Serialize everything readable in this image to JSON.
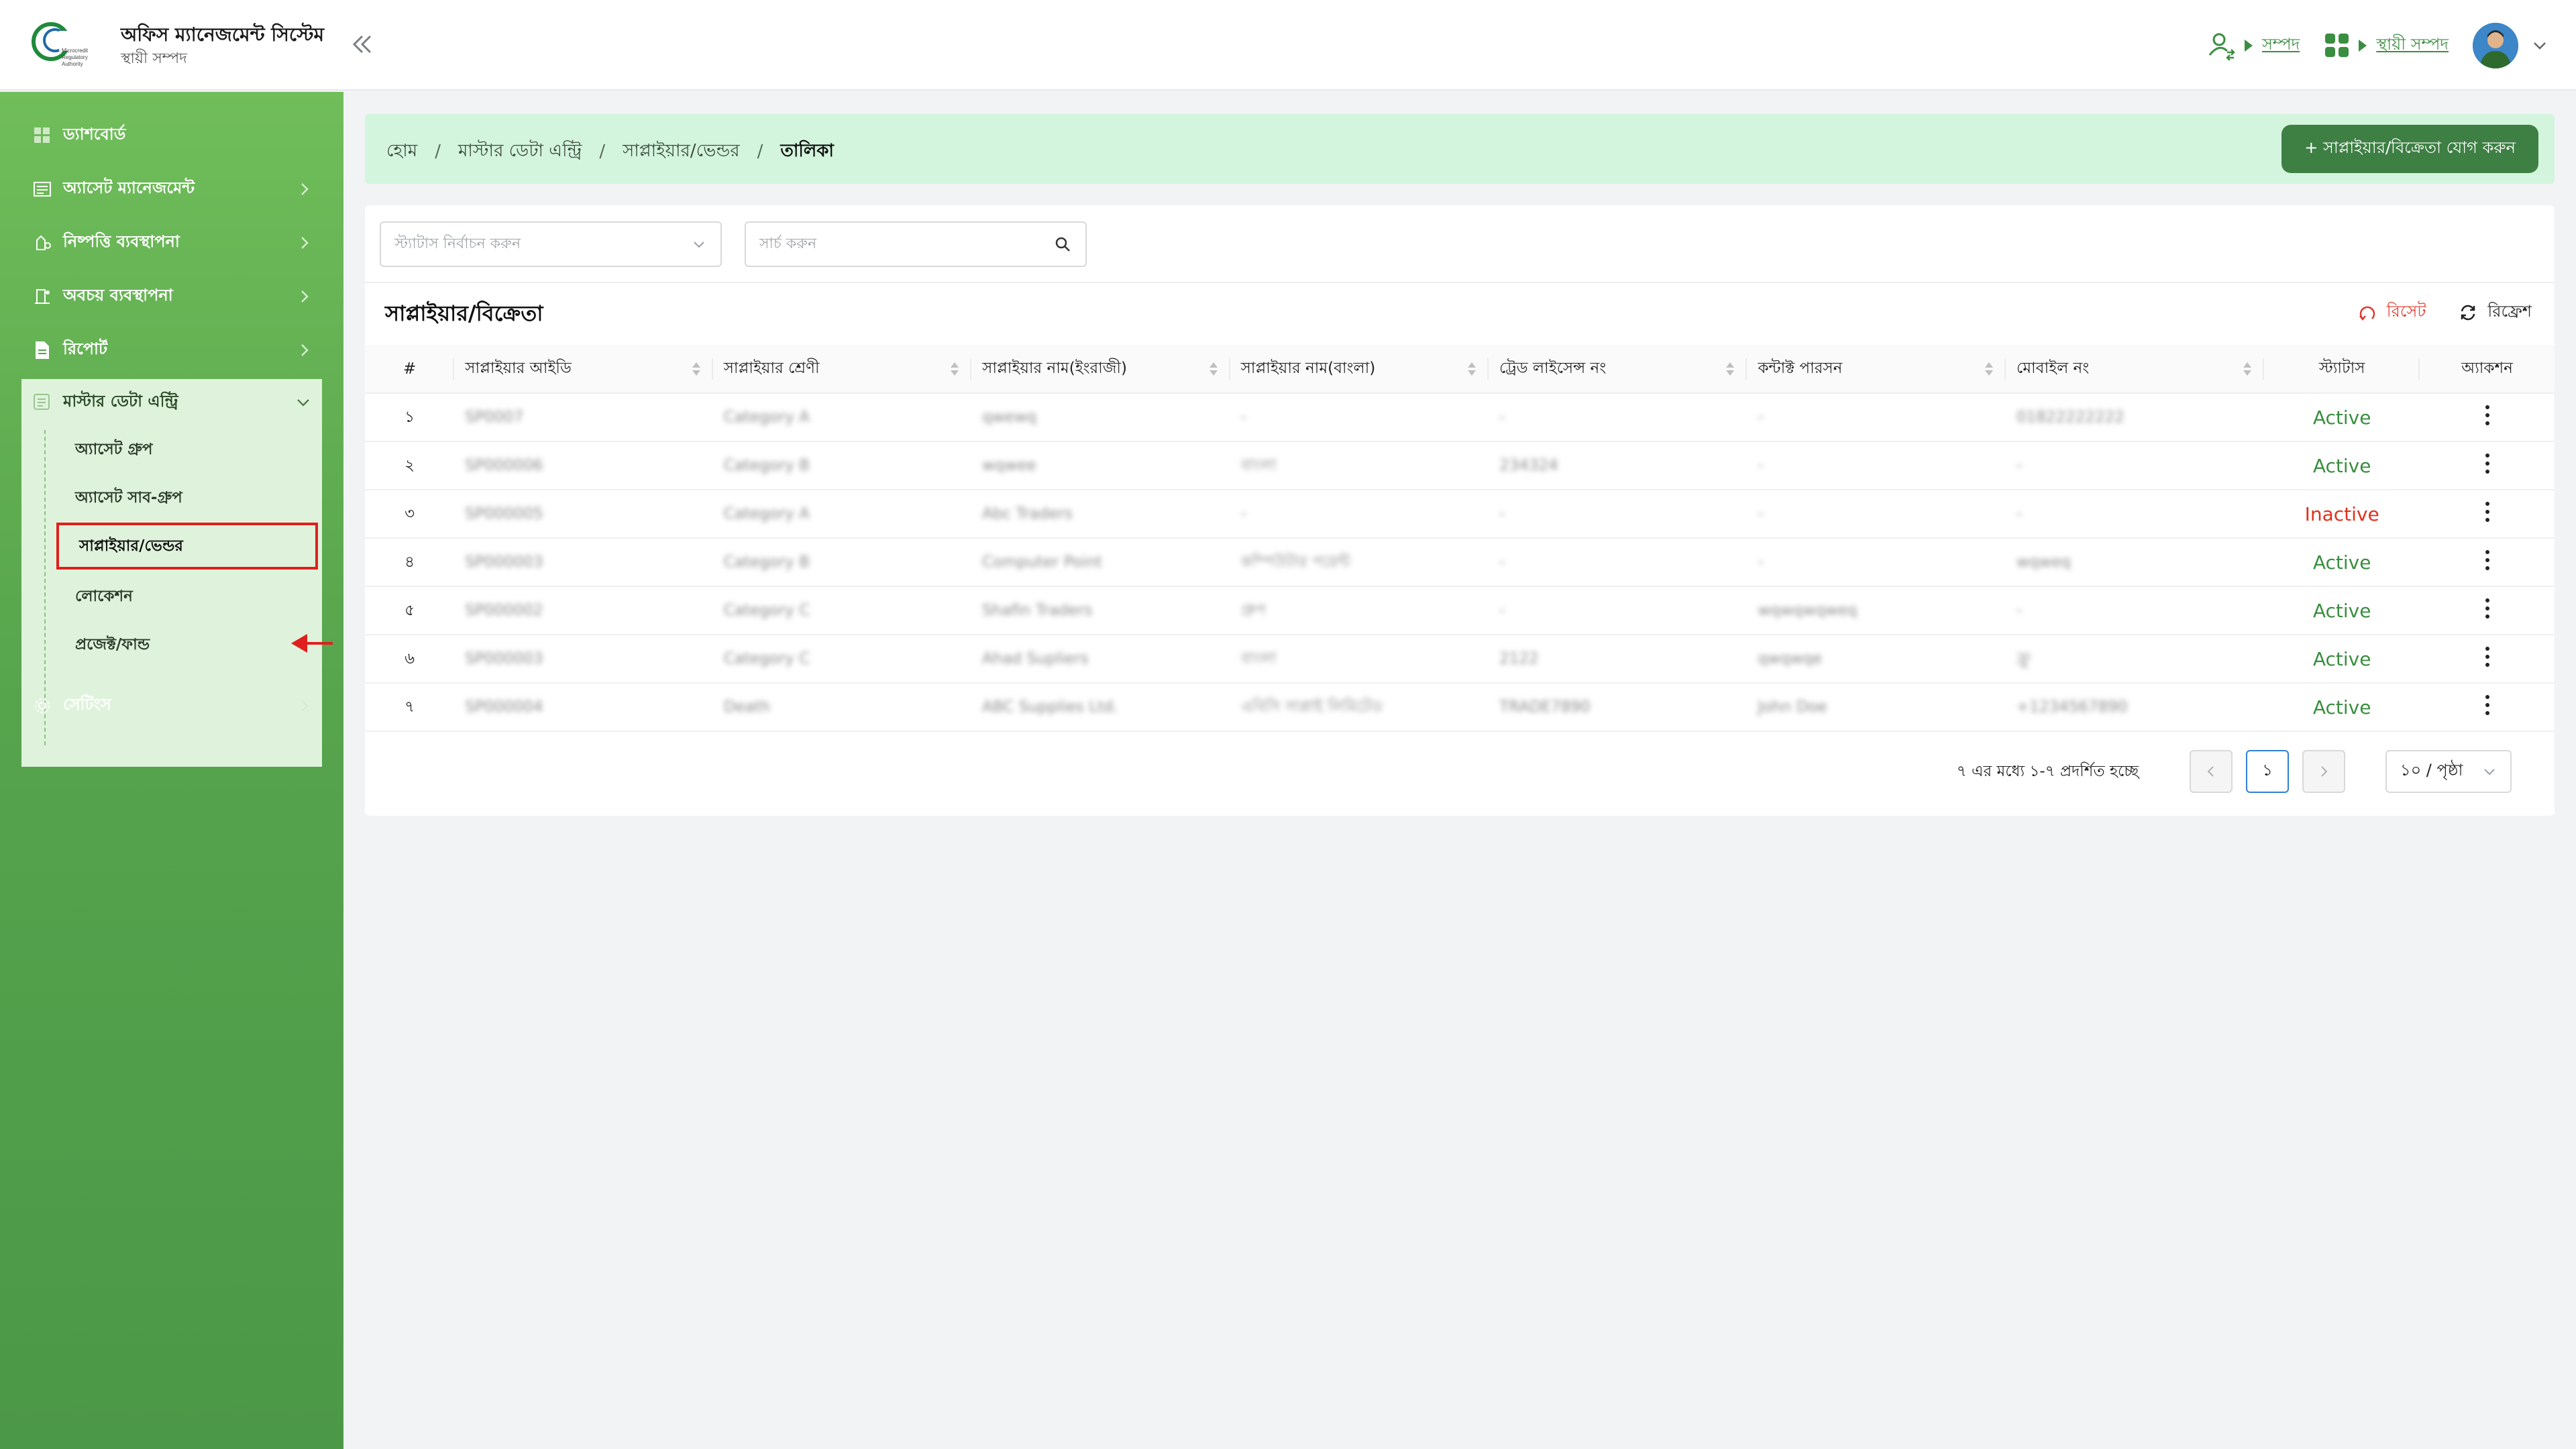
{
  "app": {
    "title": "অফিস ম্যানেজমেন্ট সিস্টেম",
    "subtitle": "স্থায়ী সম্পদ",
    "logo_text": "Microcredit Regulatory Authority"
  },
  "header": {
    "link_1": "সম্পদ",
    "link_2": "স্থায়ী সম্পদ",
    "accent_color": "#3a8e40"
  },
  "sidebar": {
    "items": [
      {
        "label": "ড্যাশবোর্ড",
        "icon": "dashboard-icon"
      },
      {
        "label": "অ্যাসেট ম্যানেজমেন্ট",
        "icon": "asset-icon"
      },
      {
        "label": "নিষ্পত্তি ব্যবস্থাপনা",
        "icon": "disposal-icon"
      },
      {
        "label": "অবচয় ব্যবস্থাপনা",
        "icon": "depreciation-icon"
      },
      {
        "label": "রিপোর্ট",
        "icon": "report-icon"
      }
    ],
    "master": {
      "label": "মাস্টার ডেটা এন্ট্রি",
      "children": [
        "অ্যাসেট গ্রুপ",
        "অ্যাসেট সাব-গ্রুপ",
        "সাপ্লাইয়ার/ভেন্ডর",
        "লোকেশন",
        "প্রজেক্ট/ফান্ড"
      ]
    },
    "settings": "সেটিংস"
  },
  "breadcrumb": {
    "home": "হোম",
    "master": "মাস্টার ডেটা এন্ট্রি",
    "supplier": "সাপ্লাইয়ার/ভেন্ডর",
    "current": "তালিকা"
  },
  "add_button": "+ সাপ্লাইয়ার/বিক্রেতা যোগ করুন",
  "filters": {
    "status_placeholder": "স্ট্যাটাস নির্বাচন করুন",
    "search_placeholder": "সার্চ করুন"
  },
  "table": {
    "title": "সাপ্লাইয়ার/বিক্রেতা",
    "reset": "রিসেট",
    "refresh": "রিফ্রেশ",
    "columns": [
      "#",
      "সাপ্লাইয়ার আইডি",
      "সাপ্লাইয়ার শ্রেণী",
      "সাপ্লাইয়ার নাম(ইংরাজী)",
      "সাপ্লাইয়ার নাম(বাংলা)",
      "ট্রেড লাইসেন্স নং",
      "কন্টাক্ট পারসন",
      "মোবাইল নং",
      "স্ট্যাটাস",
      "অ্যাকশন"
    ],
    "rows": [
      {
        "no": "১",
        "id": "SP0007",
        "category": "Category A",
        "name_en": "qwewq",
        "name_bn": "-",
        "license": "-",
        "contact": "-",
        "mobile": "01822222222",
        "status": "Active"
      },
      {
        "no": "২",
        "id": "SP000006",
        "category": "Category B",
        "name_en": "wqwee",
        "name_bn": "বাংলা",
        "license": "234324",
        "contact": "-",
        "mobile": "-",
        "status": "Active"
      },
      {
        "no": "৩",
        "id": "SP000005",
        "category": "Category A",
        "name_en": "Abc Traders",
        "name_bn": "-",
        "license": "-",
        "contact": "-",
        "mobile": "-",
        "status": "Inactive"
      },
      {
        "no": "৪",
        "id": "SP000003",
        "category": "Category B",
        "name_en": "Computer Point",
        "name_bn": "কম্পিউটার পয়েন্ট",
        "license": "-",
        "contact": "-",
        "mobile": "wqweq",
        "status": "Active"
      },
      {
        "no": "৫",
        "id": "SP000002",
        "category": "Category C",
        "name_en": "Shafin Traders",
        "name_bn": "গ্রুপ",
        "license": "-",
        "contact": "wqwqwqweq",
        "mobile": "-",
        "status": "Active"
      },
      {
        "no": "৬",
        "id": "SP000003",
        "category": "Category C",
        "name_en": "Ahad Supliers",
        "name_bn": "বাংলা",
        "license": "2122",
        "contact": "qwqwqe",
        "mobile": "ফ্রু",
        "status": "Active"
      },
      {
        "no": "৭",
        "id": "SP000004",
        "category": "Death",
        "name_en": "ABC Supplies Ltd.",
        "name_bn": "এবিসি সাপ্লাই লিমিটেড",
        "license": "TRADE7890",
        "contact": "John Doe",
        "mobile": "+1234567890",
        "status": "Active"
      }
    ]
  },
  "pagination": {
    "info": "৭ এর মধ্যে ১-৭ প্রদর্শিত হচ্ছে",
    "current_page": "১",
    "page_size": "১০ / পৃষ্ঠা"
  },
  "colors": {
    "active": "#3a8e40",
    "inactive": "#e0311c",
    "annotation": "#e0201d"
  }
}
